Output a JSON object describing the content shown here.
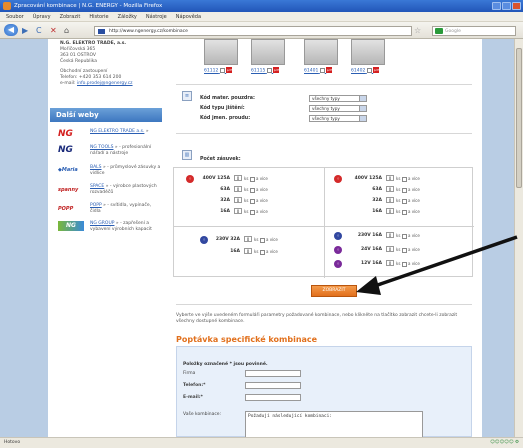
{
  "window": {
    "title": "Zpracování kombinace | N.G. ENERGY - Mozilla Firefox"
  },
  "menu": [
    "Soubor",
    "Úpravy",
    "Zobrazit",
    "Historie",
    "Záložky",
    "Nástroje",
    "Nápověda"
  ],
  "nav": {
    "url": "http://www.ngenergy.cz/kombinace",
    "search_placeholder": "Google"
  },
  "status": {
    "left": "Hotovo",
    "right": "☺☺☺☺☺ ⚙"
  },
  "leftcol": {
    "addr_lines": [
      "N.G. ELEKTRO TRADE, a.s.",
      "Mořičovská 365",
      "363 01 OSTROV",
      "Česká Republika",
      "",
      "Obchodní zastoupení",
      "Telefon: +420 353 614 200"
    ],
    "email_label": "e-mail:",
    "email": "info.prodej@ngenergy.cz",
    "dalsi_title": "Další weby",
    "sites": [
      {
        "logo": "NG",
        "link": "NG ELEKTRO TRADE a.s.",
        "desc": "»"
      },
      {
        "logo": "NG",
        "link": "NG TOOLS",
        "desc": "» - profesionální nářadí a nástroje"
      },
      {
        "logo": "◆Maria",
        "link": "BALS",
        "desc": "» - průmyslové zásuvky a vidlice"
      },
      {
        "logo": "spanny",
        "link": "SPACE",
        "desc": "» - výrobce plastových rozvaděčů"
      },
      {
        "logo": "POPP",
        "link": "POPP",
        "desc": "» - svítidla, vypínače, čidla"
      },
      {
        "logo": "NG",
        "link": "NG GROUP",
        "desc": "» - zapřešení a vybavení výrobních kapacit"
      }
    ]
  },
  "products": [
    {
      "code": "61112"
    },
    {
      "code": "61115"
    },
    {
      "code": "61401"
    },
    {
      "code": "61402"
    }
  ],
  "filters": [
    {
      "label": "Kód mater. pouzdra:",
      "value": "všechny typy"
    },
    {
      "label": "Kód typu jištění:",
      "value": "všechny typy"
    },
    {
      "label": "Kód jmen. proudu:",
      "value": "všechny typy"
    }
  ],
  "pocet_label": "Počet zásuvek:",
  "grid": {
    "cell_suffix": "ks",
    "cell_more": "a více",
    "left_top_head": "400V 125A",
    "left_top": [
      {
        "label": "400V 125A",
        "val": "0"
      },
      {
        "label": "63A",
        "val": "0"
      },
      {
        "label": "32A",
        "val": "0"
      },
      {
        "label": "16A",
        "val": "0"
      }
    ],
    "right_top": [
      {
        "label": "400V 125A",
        "val": "0"
      },
      {
        "label": "63A",
        "val": "0"
      },
      {
        "label": "32A",
        "val": "0"
      },
      {
        "label": "16A",
        "val": "0"
      }
    ],
    "left_bottom": [
      {
        "label": "230V 32A",
        "val": "0"
      },
      {
        "label": "16A",
        "val": "0"
      }
    ],
    "right_bottom": [
      {
        "label": "230V 16A",
        "val": "0"
      },
      {
        "label": "24V 16A",
        "val": "0"
      },
      {
        "label": "12V 16A",
        "val": "0"
      }
    ]
  },
  "submit_label": "ZOBRAZIT",
  "note": "Vyberte ve výše uvedeném formuláři parametry požadované kombinace, nebo klikněte na tlačítko zobrazit chcete-li zobrazit všechny dostupné kombinace.",
  "poptavka": {
    "title": "Poptávka specifické kombinace",
    "required_note": "Položky označené * jsou povinné.",
    "fields": [
      {
        "label": "Firma"
      },
      {
        "label": "Telefon:*"
      },
      {
        "label": "E-mail:*"
      },
      {
        "label": "Vaše kombinace:"
      }
    ],
    "textarea_value": "Požadují následující kombinaci:"
  }
}
